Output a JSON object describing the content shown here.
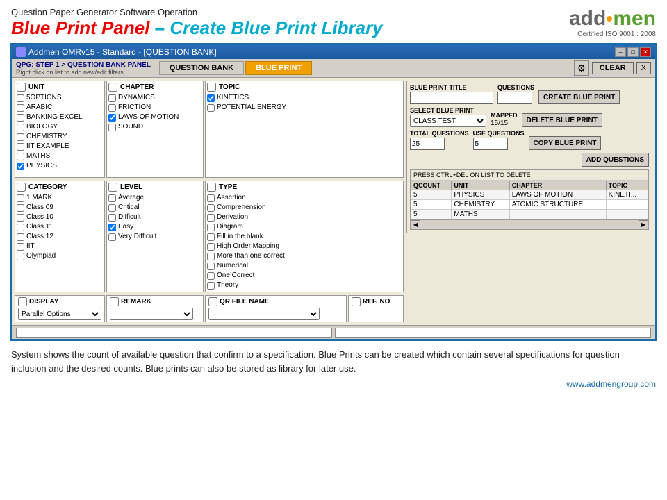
{
  "header": {
    "subtitle": "Question Paper Generator Software Operation",
    "title_red": "Blue Print Panel",
    "title_dash": " – ",
    "title_blue": "Create Blue Print Library",
    "logo_add": "add",
    "logo_men": "men",
    "logo_cert": "Certified ISO 9001 : 2008"
  },
  "window": {
    "title": "Addmen OMRv15 - Standard - [QUESTION BANK]",
    "min_btn": "–",
    "max_btn": "□",
    "close_btn": "✕"
  },
  "toolbar": {
    "breadcrumb": "QPG: STEP 1 > QUESTION BANK PANEL",
    "breadcrumb_sub": "Right click on list to add new/edit filters",
    "tab_qb": "QUESTION BANK",
    "tab_bp": "BLUE PRINT",
    "clear_label": "CLEAR",
    "x_label": "X"
  },
  "unit_col": {
    "header": "UNIT",
    "items": [
      {
        "label": "5OPTIONS",
        "checked": false
      },
      {
        "label": "ARABIC",
        "checked": false
      },
      {
        "label": "BANKING EXCEL",
        "checked": false
      },
      {
        "label": "BIOLOGY",
        "checked": false
      },
      {
        "label": "CHEMISTRY",
        "checked": false
      },
      {
        "label": "IIT EXAMPLE",
        "checked": false
      },
      {
        "label": "MATHS",
        "checked": false
      },
      {
        "label": "PHYSICS",
        "checked": true
      }
    ]
  },
  "chapter_col": {
    "header": "CHAPTER",
    "items": [
      {
        "label": "DYNAMICS",
        "checked": false
      },
      {
        "label": "FRICTION",
        "checked": false
      },
      {
        "label": "LAWS OF MOTION",
        "checked": true
      },
      {
        "label": "SOUND",
        "checked": false
      }
    ]
  },
  "topic_col": {
    "header": "TOPIC",
    "items": [
      {
        "label": "KINETICS",
        "checked": true
      },
      {
        "label": "POTENTIAL ENERGY",
        "checked": false
      }
    ]
  },
  "category_col": {
    "header": "CATEGORY",
    "items": [
      {
        "label": "1 MARK",
        "checked": false
      },
      {
        "label": "Class 09",
        "checked": false
      },
      {
        "label": "Class 10",
        "checked": false
      },
      {
        "label": "Class 11",
        "checked": false
      },
      {
        "label": "Class 12",
        "checked": false
      },
      {
        "label": "IIT",
        "checked": false
      },
      {
        "label": "Olympiad",
        "checked": false
      }
    ]
  },
  "level_col": {
    "header": "LEVEL",
    "items": [
      {
        "label": "Average",
        "checked": false
      },
      {
        "label": "Critical",
        "checked": false
      },
      {
        "label": "Difficult",
        "checked": false
      },
      {
        "label": "Easy",
        "checked": true
      },
      {
        "label": "Very Difficult",
        "checked": false
      }
    ]
  },
  "type_col": {
    "header": "TYPE",
    "items": [
      {
        "label": "Assertion",
        "checked": false
      },
      {
        "label": "Comprehension",
        "checked": false
      },
      {
        "label": "Derivation",
        "checked": false
      },
      {
        "label": "Diagram",
        "checked": false
      },
      {
        "label": "Fill in the blank",
        "checked": false
      },
      {
        "label": "High Order Mapping",
        "checked": false
      },
      {
        "label": "More than one correct",
        "checked": false
      },
      {
        "label": "Numerical",
        "checked": false
      },
      {
        "label": "One Correct",
        "checked": false
      },
      {
        "label": "Theory",
        "checked": false
      }
    ]
  },
  "display_col": {
    "header": "DISPLAY",
    "option": "Parallel Options"
  },
  "remark_col": {
    "header": "REMARK"
  },
  "qr_col": {
    "header": "QR FILE NAME"
  },
  "ref_col": {
    "header": "REF. NO"
  },
  "bp_form": {
    "bp_title_label": "BLUE PRINT TITLE",
    "questions_label": "QUESTIONS",
    "select_bp_label": "SELECT BLUE PRINT",
    "mapped_label": "MAPPED",
    "mapped_value": "15/15",
    "total_q_label": "TOTAL QUESTIONS",
    "total_q_value": "25",
    "use_q_label": "USE QUESTIONS",
    "use_q_value": "5",
    "class_test": "CLASS TEST",
    "create_btn": "CREATE BLUE PRINT",
    "delete_btn": "DELETE BLUE PRINT",
    "copy_btn": "COPY BLUE PRINT",
    "add_btn": "ADD QUESTIONS",
    "press_label": "PRESS CTRL+DEL ON LIST TO DELETE"
  },
  "bp_table": {
    "headers": [
      "QCOUNT",
      "UNIT",
      "CHAPTER",
      "TOPIC"
    ],
    "rows": [
      {
        "qcount": "5",
        "unit": "PHYSICS",
        "chapter": "LAWS OF MOTION",
        "topic": "KINETI..."
      },
      {
        "qcount": "5",
        "unit": "CHEMISTRY",
        "chapter": "ATOMIC STRUCTURE",
        "topic": ""
      },
      {
        "qcount": "5",
        "unit": "MATHS",
        "chapter": "",
        "topic": ""
      }
    ]
  },
  "bottom_text": "System shows the count of available question that confirm to a specification. Blue Prints can be created which contain several specifications for question inclusion and the desired counts. Blue prints can also be stored as library for later use.",
  "website": "www.addmengroup.com"
}
